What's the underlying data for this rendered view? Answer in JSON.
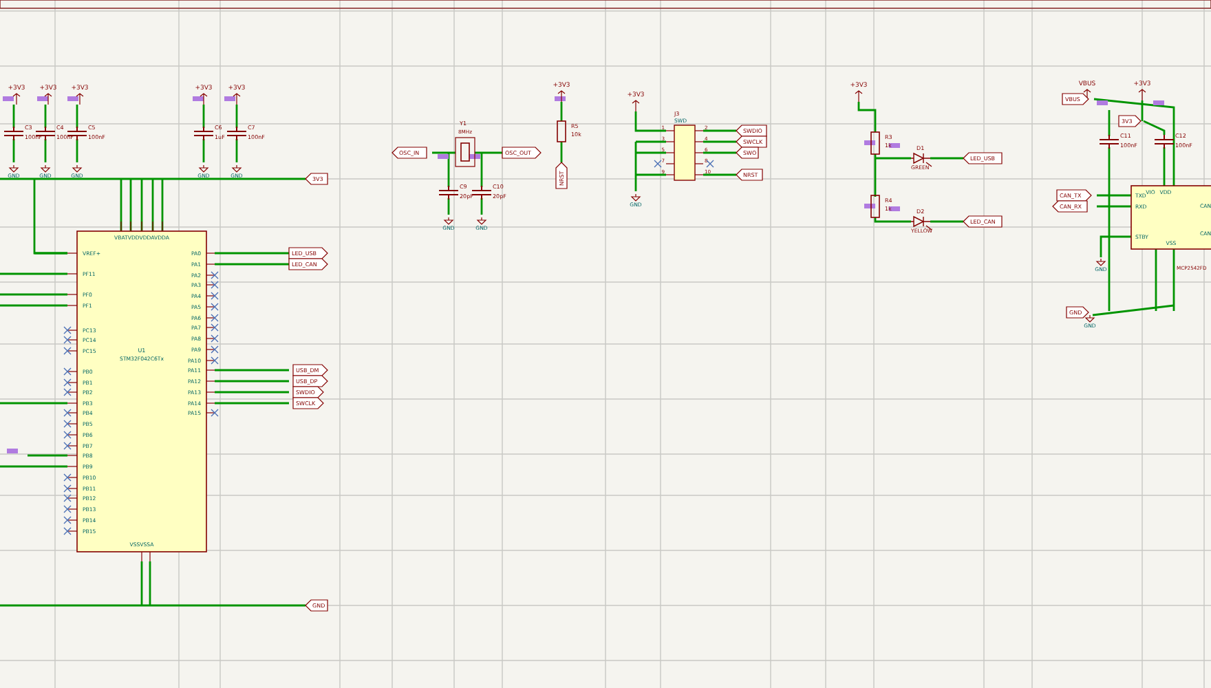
{
  "power_symbols": [
    {
      "label": "+3V3"
    },
    {
      "label": "+3V3"
    },
    {
      "label": "+3V3"
    },
    {
      "label": "+3V3"
    },
    {
      "label": "+3V3"
    },
    {
      "label": "+3V3"
    },
    {
      "label": "+3V3"
    },
    {
      "label": "+3V3"
    },
    {
      "label": "VBUS"
    },
    {
      "label": "+3V3"
    }
  ],
  "capacitors": [
    {
      "ref": "C3",
      "value": "100nF"
    },
    {
      "ref": "C4",
      "value": "100nF"
    },
    {
      "ref": "C5",
      "value": "100nF"
    },
    {
      "ref": "C6",
      "value": "1uF"
    },
    {
      "ref": "C7",
      "value": "100nF"
    },
    {
      "ref": "C9",
      "value": "20pF"
    },
    {
      "ref": "C10",
      "value": "20pF"
    },
    {
      "ref": "C11",
      "value": "100nF"
    },
    {
      "ref": "C12",
      "value": "100nF"
    }
  ],
  "ground_symbols": [
    {
      "label": "GND"
    },
    {
      "label": "GND"
    },
    {
      "label": "GND"
    },
    {
      "label": "GND"
    },
    {
      "label": "GND"
    },
    {
      "label": "GND"
    },
    {
      "label": "GND"
    },
    {
      "label": "GND"
    },
    {
      "label": "GND"
    },
    {
      "label": "GND"
    }
  ],
  "mcu": {
    "ref": "U1",
    "part": "STM32F042C6Tx",
    "top_pins": "VBATVDDVDDAVDDA",
    "bottom_pins": "VSSVSSA",
    "left_pins": [
      {
        "name": "VREF+",
        "connected": true
      },
      {
        "name": "PF11",
        "connected": true
      },
      {
        "name": "PF0",
        "connected": true
      },
      {
        "name": "PF1",
        "connected": true
      },
      {
        "name": "PC13",
        "connected": false
      },
      {
        "name": "PC14",
        "connected": false
      },
      {
        "name": "PC15",
        "connected": false
      },
      {
        "name": "PB0",
        "connected": false
      },
      {
        "name": "PB1",
        "connected": false
      },
      {
        "name": "PB2",
        "connected": false
      },
      {
        "name": "PB3",
        "connected": true
      },
      {
        "name": "PB4",
        "connected": false
      },
      {
        "name": "PB5",
        "connected": false
      },
      {
        "name": "PB6",
        "connected": false
      },
      {
        "name": "PB7",
        "connected": false
      },
      {
        "name": "PB8",
        "connected": true
      },
      {
        "name": "PB9",
        "connected": true
      },
      {
        "name": "PB10",
        "connected": false
      },
      {
        "name": "PB11",
        "connected": false
      },
      {
        "name": "PB12",
        "connected": false
      },
      {
        "name": "PB13",
        "connected": false
      },
      {
        "name": "PB14",
        "connected": false
      },
      {
        "name": "PB15",
        "connected": false
      }
    ],
    "right_pins": [
      {
        "name": "PA0",
        "connected": true
      },
      {
        "name": "PA1",
        "connected": true
      },
      {
        "name": "PA2",
        "connected": false
      },
      {
        "name": "PA3",
        "connected": false
      },
      {
        "name": "PA4",
        "connected": false
      },
      {
        "name": "PA5",
        "connected": false
      },
      {
        "name": "PA6",
        "connected": false
      },
      {
        "name": "PA7",
        "connected": false
      },
      {
        "name": "PA8",
        "connected": false
      },
      {
        "name": "PA9",
        "connected": false
      },
      {
        "name": "PA10",
        "connected": false
      },
      {
        "name": "PA11",
        "connected": true
      },
      {
        "name": "PA12",
        "connected": true
      },
      {
        "name": "PA13",
        "connected": true
      },
      {
        "name": "PA14",
        "connected": true
      },
      {
        "name": "PA15",
        "connected": false
      }
    ]
  },
  "net_labels": [
    {
      "text": "3V3"
    },
    {
      "text": "LED_USB"
    },
    {
      "text": "LED_CAN"
    },
    {
      "text": "USB_DM"
    },
    {
      "text": "USB_DP"
    },
    {
      "text": "SWDIO"
    },
    {
      "text": "SWCLK"
    },
    {
      "text": "GND"
    },
    {
      "text": "OSC_IN"
    },
    {
      "text": "OSC_OUT"
    },
    {
      "text": "NRST"
    },
    {
      "text": "SWDIO"
    },
    {
      "text": "SWCLK"
    },
    {
      "text": "SWO"
    },
    {
      "text": "NRST"
    },
    {
      "text": "LED_USB"
    },
    {
      "text": "LED_CAN"
    },
    {
      "text": "VBUS"
    },
    {
      "text": "3V3"
    },
    {
      "text": "CAN_TX"
    },
    {
      "text": "CAN_RX"
    },
    {
      "text": "GND"
    }
  ],
  "crystal": {
    "ref": "Y1",
    "value": "8MHz"
  },
  "resistors": [
    {
      "ref": "R5",
      "value": "10k"
    },
    {
      "ref": "R3",
      "value": "1k"
    },
    {
      "ref": "R4",
      "value": "1k"
    }
  ],
  "leds": [
    {
      "ref": "D1",
      "value": "GREEN"
    },
    {
      "ref": "D2",
      "value": "YELLOW"
    }
  ],
  "connector": {
    "ref": "J3",
    "value": "SWD",
    "pins": [
      "1",
      "2",
      "3",
      "4",
      "5",
      "6",
      "7",
      "8",
      "9",
      "10"
    ]
  },
  "transceiver": {
    "part": "MCP2542FD",
    "pins": [
      "TXD",
      "RXD",
      "STBY",
      "VIO",
      "VDD",
      "VSS"
    ],
    "right_pins": [
      "CAN",
      "CAN"
    ]
  }
}
